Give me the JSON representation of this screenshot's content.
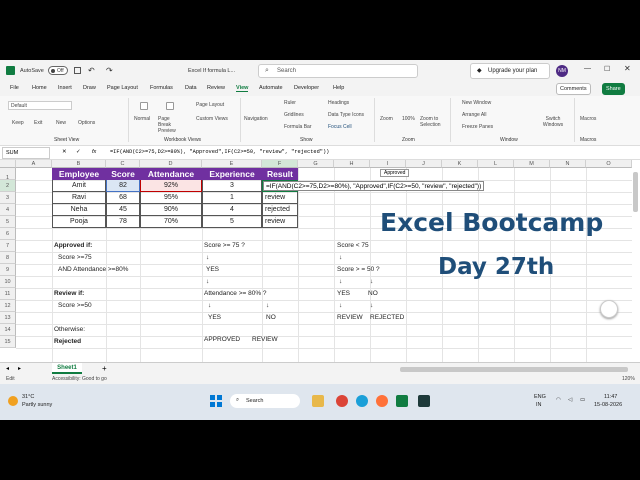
{
  "titlebar": {
    "autosave_label": "AutoSave",
    "autosave_state": "Off",
    "file_name": "Excel If formula L...",
    "search_placeholder": "Search",
    "upgrade_label": "Upgrade your plan",
    "avatar_initials": "NM"
  },
  "menu": {
    "items": [
      "File",
      "Home",
      "Insert",
      "Draw",
      "Page Layout",
      "Formulas",
      "Data",
      "Review",
      "View",
      "Automate",
      "Developer",
      "Help"
    ],
    "active": "View",
    "comments_label": "Comments",
    "share_label": "Share"
  },
  "ribbon": {
    "sheet_view": {
      "default": "Default",
      "keep": "Keep",
      "exit": "Exit",
      "new": "New",
      "options": "Options",
      "group": "Sheet View"
    },
    "workbook_views": {
      "normal": "Normal",
      "page_break": "Page Break Preview",
      "page_layout": "Page Layout",
      "custom_views": "Custom Views",
      "group": "Workbook Views"
    },
    "show": {
      "navigation": "Navigation",
      "ruler": "Ruler",
      "gridlines": "Gridlines",
      "formula_bar": "Formula Bar",
      "headings": "Headings",
      "data_types": "Data Type Icons",
      "focus_cell": "Focus Cell",
      "group": "Show"
    },
    "zoom": {
      "zoom": "Zoom",
      "hundred": "100%",
      "zoom_sel": "Zoom to Selection",
      "group": "Zoom"
    },
    "window": {
      "new_window": "New Window",
      "arrange_all": "Arrange All",
      "freeze": "Freeze Panes",
      "switch": "Switch Windows",
      "group": "Window"
    },
    "macros": {
      "macros": "Macros",
      "group": "Macros"
    }
  },
  "formula_bar": {
    "name_box": "SUM",
    "fx": "fx",
    "formula": "=IF(AND(C2>=75,D2>=80%), \"Approved\",IF(C2>=50, \"review\", \"rejected\"))"
  },
  "columns": [
    "A",
    "B",
    "C",
    "D",
    "E",
    "F",
    "G",
    "H",
    "I",
    "J",
    "K",
    "L",
    "M",
    "N",
    "O"
  ],
  "rows": [
    "1",
    "2",
    "3",
    "4",
    "5",
    "6",
    "7",
    "8",
    "9",
    "10",
    "11",
    "12",
    "13",
    "14",
    "15"
  ],
  "table": {
    "headers": [
      "Employee",
      "Score",
      "Attendance",
      "Experience",
      "Result"
    ],
    "rows": [
      [
        "Amit",
        "82",
        "92%",
        "3",
        ""
      ],
      [
        "Ravi",
        "68",
        "95%",
        "1",
        "review"
      ],
      [
        "Neha",
        "45",
        "90%",
        "4",
        "rejected"
      ],
      [
        "Pooja",
        "78",
        "70%",
        "5",
        "review"
      ]
    ],
    "editing_formula": "=IF(AND(C2>=75,D2>=80%), \"Approved\",IF(C2>=50, \"review\", \"rejected\"))",
    "tooltip": "Approved"
  },
  "notes": {
    "approved_if": "Approved if:",
    "score75": "Score >=75",
    "att80": "AND Attendance >=80%",
    "review_if": "Review if:",
    "score50": "Score >=50",
    "otherwise": "Otherwise:",
    "rejected": "Rejected",
    "f_score75": "Score >= 75 ?",
    "f_arrow1": "↓",
    "f_yes1": "YES",
    "f_arrow2": "↓",
    "f_att": "Attendance >= 80% ?",
    "f_arrow3": "↓",
    "f_arrow4": "↓",
    "f_yes2": "YES",
    "f_no2": "NO",
    "f_approved": "APPROVED",
    "f_review": "REVIEW",
    "h_score75": "Score < 75",
    "h_arrow1": "↓",
    "h_score50": "Score >  = 50 ?",
    "h_arrow2": "↓",
    "h_arrow3": "↓",
    "h_yes": "YES",
    "h_no": "NO",
    "h_arrow4": "↓",
    "h_arrow5": "↓",
    "h_review": "REVIEW",
    "h_rejected": "REJECTED"
  },
  "overlay": {
    "line1": "Excel Bootcamp",
    "line2": "Day 27th"
  },
  "sheets": {
    "active": "Sheet1",
    "add": "+"
  },
  "status": {
    "mode": "Edit",
    "accessibility": "Accessibility: Good to go",
    "zoom": "120%"
  },
  "taskbar": {
    "temp": "31°C",
    "weather": "Partly sunny",
    "search": "Search",
    "lang1": "ENG",
    "lang2": "IN",
    "time": "11:47",
    "date": "15-08-2026"
  },
  "colors": {
    "header_bg": "#7030a0",
    "excel_green": "#107c41",
    "title_blue": "#1f4e79"
  }
}
